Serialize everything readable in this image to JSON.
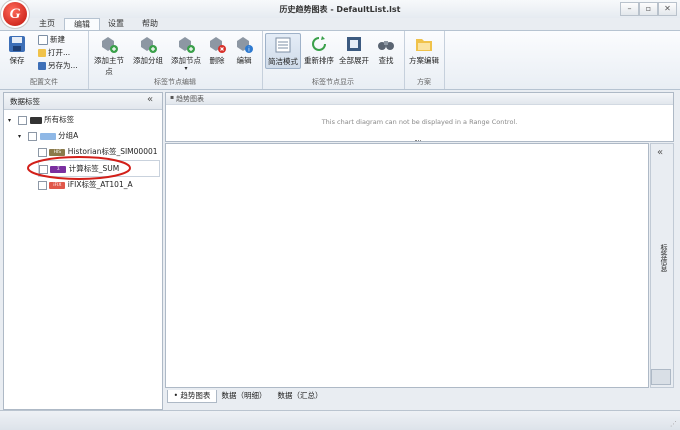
{
  "window": {
    "title": "历史趋势图表 - DefaultList.lst",
    "logo_letter": "G",
    "minimize": "–",
    "restore": "▫",
    "close": "✕"
  },
  "tabs": [
    "主页",
    "编辑",
    "设置",
    "帮助"
  ],
  "ribbon": {
    "config_group": {
      "save_label": "保存",
      "new_label": "新建",
      "open_label": "打开...",
      "saveas_label": "另存为...",
      "group_label": "配置文件"
    },
    "node_edit_group": {
      "add_main_label": "添加主节点",
      "add_group_label": "添加分组",
      "add_node_label": "添加节点",
      "delete_label": "删除",
      "edit_label": "编辑",
      "group_label": "标签节点编辑"
    },
    "node_display_group": {
      "brief_label": "简洁模式",
      "resort_label": "重新排序",
      "expand_label": "全部展开",
      "find_label": "查找",
      "group_label": "标签节点显示"
    },
    "scheme_group": {
      "scheme_edit_label": "方案编辑",
      "group_label": "方案"
    }
  },
  "left_panel": {
    "title": "数据标签",
    "collapse": "«",
    "tree": [
      {
        "level": 0,
        "toggle": "▾",
        "badge": "",
        "badge_color": "#333333",
        "label": "所有标签"
      },
      {
        "level": 1,
        "toggle": "▾",
        "badge": "",
        "badge_color": "#8fb8e6",
        "label": "分组A"
      },
      {
        "level": 2,
        "toggle": "",
        "badge": "HIS",
        "badge_color": "#8a7a4a",
        "label": "Historian标签_SIM00001"
      },
      {
        "level": 2,
        "toggle": "",
        "badge": "Σ",
        "badge_color": "#7a2fa0",
        "label": "计算标签_SUM"
      },
      {
        "level": 2,
        "toggle": "",
        "badge": "iFIX",
        "badge_color": "#e0584a",
        "label": "iFIX标签_AT101_A"
      }
    ]
  },
  "chart_panel": {
    "title": "趋势图表",
    "range_message": "This chart diagram can not be displayed in a Range Control."
  },
  "right_strip": {
    "collapse": "«",
    "label": "标签信息"
  },
  "bottom_tabs": [
    "趋势图表",
    "数据（明细）",
    "数据（汇总）"
  ],
  "colors": {
    "accent": "#2b6fc2",
    "highlight_ellipse": "#d2201a"
  }
}
